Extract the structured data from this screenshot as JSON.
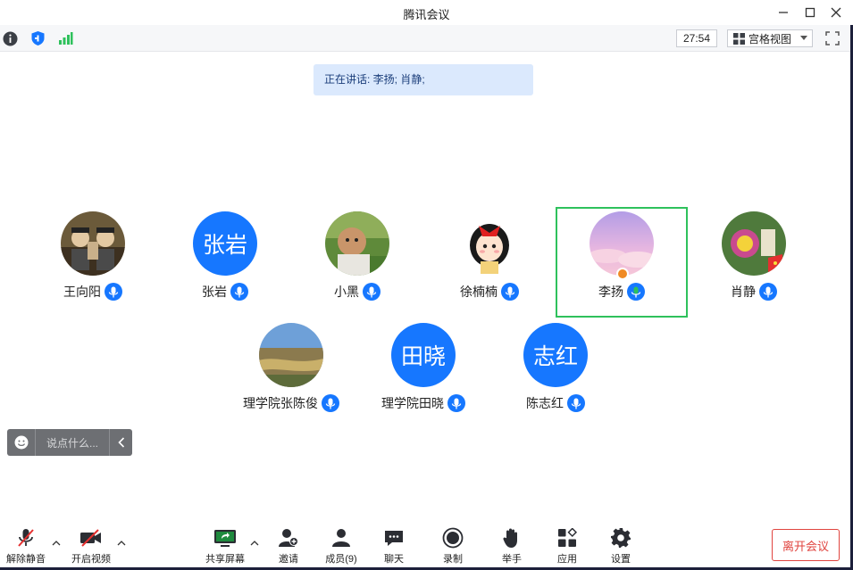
{
  "window": {
    "title": "腾讯会议"
  },
  "infobar": {
    "timer": "27:54",
    "view_mode": "宫格视图"
  },
  "speaking": {
    "text": "正在讲话: 李扬; 肖静;"
  },
  "participants": [
    {
      "name": "王向阳",
      "avatar_type": "photo"
    },
    {
      "name": "张岩",
      "avatar_type": "text",
      "avatar_text": "张岩"
    },
    {
      "name": "小黑",
      "avatar_type": "photo"
    },
    {
      "name": "徐楠楠",
      "avatar_type": "photo"
    },
    {
      "name": "李扬",
      "avatar_type": "photo",
      "active": true
    },
    {
      "name": "肖静",
      "avatar_type": "photo"
    },
    {
      "name": "理学院张陈俊",
      "avatar_type": "photo"
    },
    {
      "name": "理学院田晓",
      "avatar_type": "text",
      "avatar_text": "田晓"
    },
    {
      "name": "陈志红",
      "avatar_type": "text",
      "avatar_text": "志红"
    }
  ],
  "chat": {
    "placeholder": "说点什么..."
  },
  "toolbar": {
    "unmute": "解除静音",
    "start_video": "开启视频",
    "share_screen": "共享屏幕",
    "invite": "邀请",
    "members": "成员(9)",
    "chat": "聊天",
    "record": "录制",
    "raise_hand": "举手",
    "apps": "应用",
    "settings": "设置",
    "leave": "离开会议"
  },
  "colors": {
    "accent": "#1677ff",
    "active_border": "#2ec15c",
    "leave": "#e0443f",
    "banner": "#dbe9fd"
  }
}
